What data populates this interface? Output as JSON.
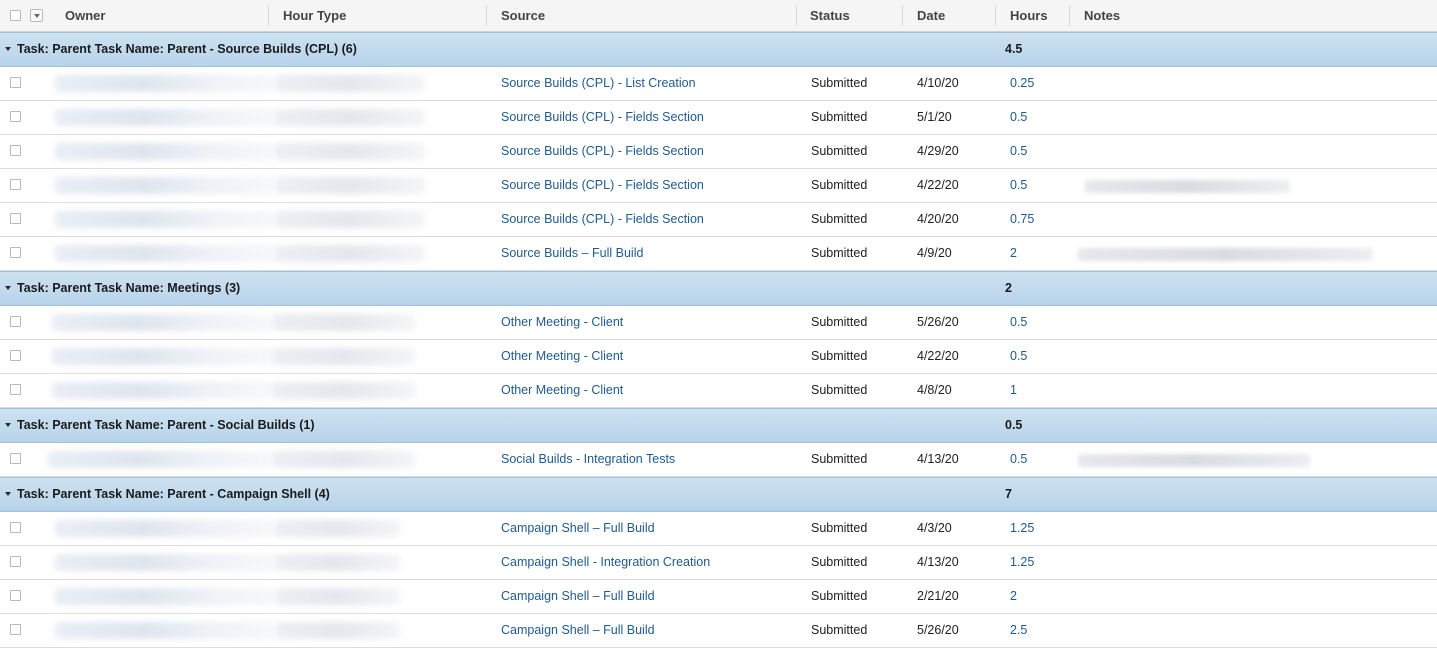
{
  "columns": {
    "owner": "Owner",
    "hour_type": "Hour Type",
    "source": "Source",
    "status": "Status",
    "date": "Date",
    "hours": "Hours",
    "notes": "Notes"
  },
  "groups": [
    {
      "title": "Task: Parent Task Name: Parent - Source Builds (CPL) (6)",
      "total": "4.5",
      "rows": [
        {
          "source": "Source Builds (CPL) - List Creation",
          "status": "Submitted",
          "date": "4/10/20",
          "hours": "0.25"
        },
        {
          "source": "Source Builds (CPL) - Fields Section",
          "status": "Submitted",
          "date": "5/1/20",
          "hours": "0.5"
        },
        {
          "source": "Source Builds (CPL) - Fields Section",
          "status": "Submitted",
          "date": "4/29/20",
          "hours": "0.5"
        },
        {
          "source": "Source Builds (CPL) - Fields Section",
          "status": "Submitted",
          "date": "4/22/20",
          "hours": "0.5"
        },
        {
          "source": "Source Builds (CPL) - Fields Section",
          "status": "Submitted",
          "date": "4/20/20",
          "hours": "0.75"
        },
        {
          "source": "Source Builds – Full Build",
          "status": "Submitted",
          "date": "4/9/20",
          "hours": "2"
        }
      ]
    },
    {
      "title": "Task: Parent Task Name: Meetings (3)",
      "total": "2",
      "rows": [
        {
          "source": "Other Meeting - Client",
          "status": "Submitted",
          "date": "5/26/20",
          "hours": "0.5"
        },
        {
          "source": "Other Meeting - Client",
          "status": "Submitted",
          "date": "4/22/20",
          "hours": "0.5"
        },
        {
          "source": "Other Meeting - Client",
          "status": "Submitted",
          "date": "4/8/20",
          "hours": "1"
        }
      ]
    },
    {
      "title": "Task: Parent Task Name: Parent - Social Builds (1)",
      "total": "0.5",
      "rows": [
        {
          "source": "Social Builds - Integration Tests",
          "status": "Submitted",
          "date": "4/13/20",
          "hours": "0.5"
        }
      ]
    },
    {
      "title": "Task: Parent Task Name: Parent - Campaign Shell (4)",
      "total": "7",
      "rows": [
        {
          "source": "Campaign Shell – Full Build",
          "status": "Submitted",
          "date": "4/3/20",
          "hours": "1.25"
        },
        {
          "source": "Campaign Shell - Integration Creation",
          "status": "Submitted",
          "date": "4/13/20",
          "hours": "1.25"
        },
        {
          "source": "Campaign Shell – Full Build",
          "status": "Submitted",
          "date": "2/21/20",
          "hours": "2"
        },
        {
          "source": "Campaign Shell – Full Build",
          "status": "Submitted",
          "date": "5/26/20",
          "hours": "2.5"
        }
      ]
    }
  ]
}
